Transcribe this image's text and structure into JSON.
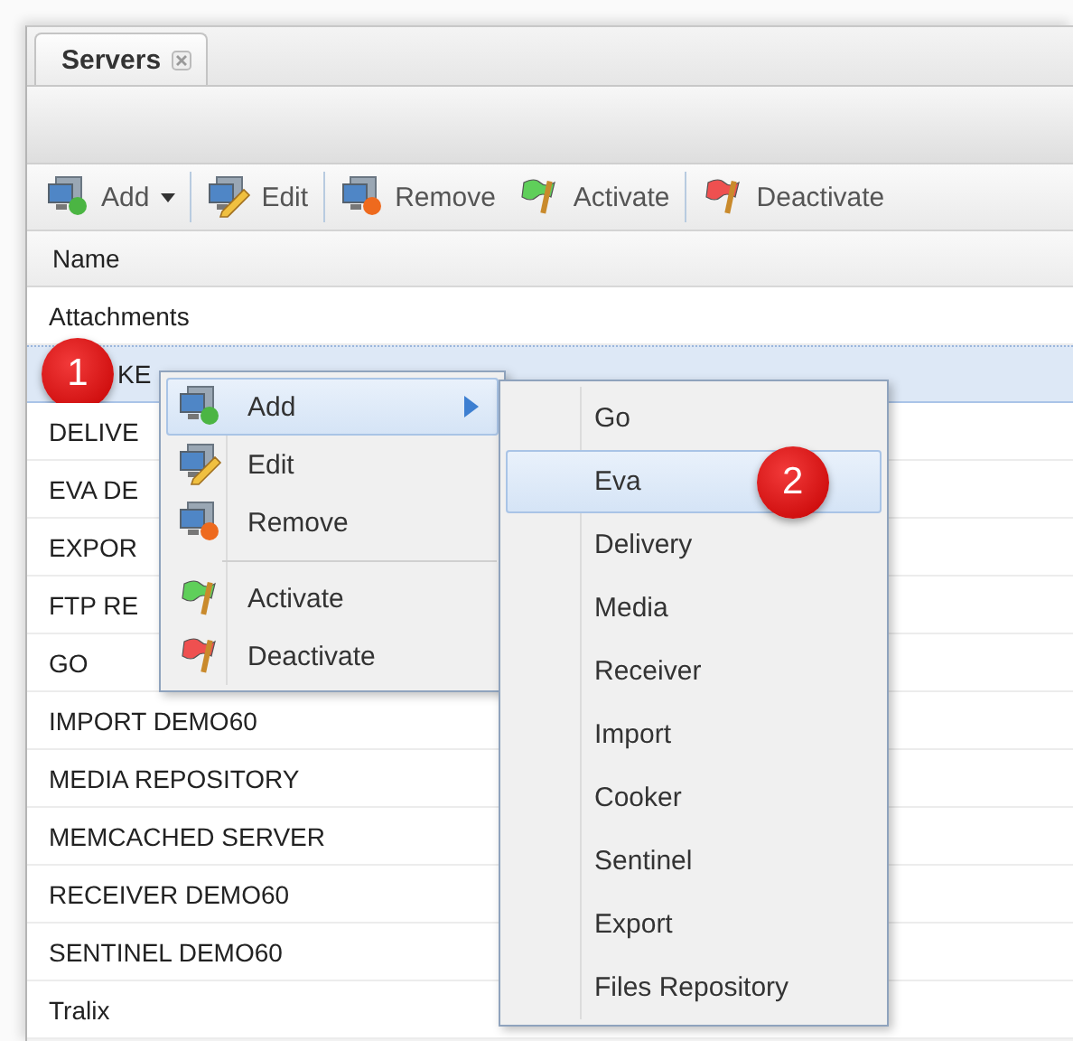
{
  "tab": {
    "label": "Servers",
    "selected": true
  },
  "toolbar": [
    {
      "kind": "add",
      "label": "Add",
      "dropdown": true,
      "separator_before": false
    },
    {
      "kind": "edit",
      "label": "Edit",
      "dropdown": false,
      "separator_before": true
    },
    {
      "kind": "remove",
      "label": "Remove",
      "dropdown": false,
      "separator_before": true
    },
    {
      "kind": "activate",
      "label": "Activate",
      "dropdown": false,
      "separator_before": false
    },
    {
      "kind": "deactivate",
      "label": "Deactivate",
      "dropdown": false,
      "separator_before": true
    }
  ],
  "table": {
    "columns": [
      "Name"
    ],
    "rows": [
      {
        "name": "Attachments",
        "selected": false
      },
      {
        "name": "KE",
        "selected": true,
        "badge": "1"
      },
      {
        "name": "DELIVE",
        "selected": false
      },
      {
        "name": "EVA DE",
        "selected": false
      },
      {
        "name": "EXPOR",
        "selected": false
      },
      {
        "name": "FTP RE",
        "selected": false
      },
      {
        "name": "GO",
        "selected": false
      },
      {
        "name": "IMPORT DEMO60",
        "selected": false
      },
      {
        "name": "MEDIA REPOSITORY",
        "selected": false
      },
      {
        "name": "MEMCACHED SERVER",
        "selected": false
      },
      {
        "name": "RECEIVER DEMO60",
        "selected": false
      },
      {
        "name": "SENTINEL DEMO60",
        "selected": false
      },
      {
        "name": "Tralix",
        "selected": false
      }
    ]
  },
  "context_menu": [
    {
      "kind": "add",
      "label": "Add",
      "selected": true,
      "submenu": true,
      "separator_before": false
    },
    {
      "kind": "edit",
      "label": "Edit",
      "selected": false,
      "submenu": false,
      "separator_before": false
    },
    {
      "kind": "remove",
      "label": "Remove",
      "selected": false,
      "submenu": false,
      "separator_before": false
    },
    {
      "kind": "activate",
      "label": "Activate",
      "selected": false,
      "submenu": false,
      "separator_before": true
    },
    {
      "kind": "deactivate",
      "label": "Deactivate",
      "selected": false,
      "submenu": false,
      "separator_before": false
    }
  ],
  "submenu": [
    {
      "label": "Go",
      "selected": false
    },
    {
      "label": "Eva",
      "selected": true,
      "badge": "2"
    },
    {
      "label": "Delivery",
      "selected": false
    },
    {
      "label": "Media",
      "selected": false
    },
    {
      "label": "Receiver",
      "selected": false
    },
    {
      "label": "Import",
      "selected": false
    },
    {
      "label": "Cooker",
      "selected": false
    },
    {
      "label": "Sentinel",
      "selected": false
    },
    {
      "label": "Export",
      "selected": false
    },
    {
      "label": "Files Repository",
      "selected": false
    }
  ]
}
